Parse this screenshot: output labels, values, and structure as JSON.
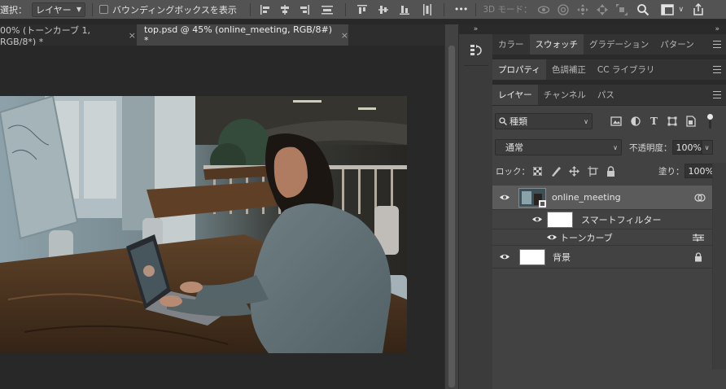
{
  "options_bar": {
    "select_label": "選択：",
    "select_value": "レイヤー",
    "bounding_box_label": "バウンディングボックスを表示",
    "more_label": "•••",
    "mode_3d_label": "3D モード："
  },
  "tabs": [
    {
      "label": "00% (トーンカーブ 1, RGB/8*) *",
      "close": "×"
    },
    {
      "label": "top.psd @ 45% (online_meeting, RGB/8#) *",
      "close": "×"
    }
  ],
  "panel_header": {
    "collapse": "»",
    "expand": "«"
  },
  "color_panel_tabs": [
    "カラー",
    "スウォッチ",
    "グラデーション",
    "パターン"
  ],
  "color_panel_active": 1,
  "props_panel_tabs": [
    "プロパティ",
    "色調補正",
    "CC ライブラリ"
  ],
  "props_panel_active": 0,
  "layers_panel_tabs": [
    "レイヤー",
    "チャンネル",
    "パス"
  ],
  "layers_panel_active": 0,
  "layers_panel": {
    "filter_label": "種類",
    "blend_mode": "通常",
    "opacity_label": "不透明度：",
    "opacity_value": "100%",
    "lock_label": "ロック：",
    "fill_label": "塗り：",
    "fill_value": "100%"
  },
  "layers": [
    {
      "name": "online_meeting",
      "kind": "smart-object",
      "selected": true
    },
    {
      "name": "スマートフィルター",
      "kind": "smart-filter-mask"
    },
    {
      "name": "トーンカーブ",
      "kind": "filter"
    },
    {
      "name": "背景",
      "kind": "background",
      "locked": true
    }
  ],
  "colors": {
    "app_bg": "#282828",
    "options_bar": "#535353",
    "panel_bg": "#424242",
    "selected_layer": "#5b5b5b"
  }
}
